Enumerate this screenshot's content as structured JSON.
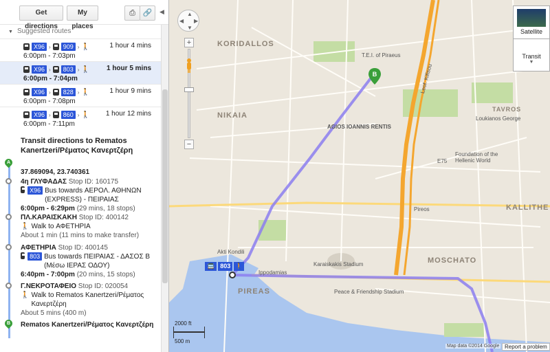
{
  "toolbar": {
    "get_directions": "Get directions",
    "my_places": "My places",
    "print_icon": "print-icon",
    "link_icon": "link-icon"
  },
  "sidebar": {
    "suggested_routes_label": "Suggested routes",
    "routes": [
      {
        "buses": [
          "X96",
          "909"
        ],
        "duration": "1 hour 4 mins",
        "times": "6:00pm - 7:03pm",
        "selected": false
      },
      {
        "buses": [
          "X96",
          "803"
        ],
        "duration": "1 hour 5 mins",
        "times": "6:00pm - 7:04pm",
        "selected": true
      },
      {
        "buses": [
          "X96",
          "828"
        ],
        "duration": "1 hour 9 mins",
        "times": "6:00pm - 7:08pm",
        "selected": false
      },
      {
        "buses": [
          "X96",
          "860"
        ],
        "duration": "1 hour 12 mins",
        "times": "6:00pm - 7:11pm",
        "selected": false
      }
    ],
    "directions_title": "Transit directions to Rematos Kanertzeri/Ρέματος Κανερτζέρη",
    "start": {
      "marker": "A",
      "coords": "37.869094, 23.740361"
    },
    "steps": [
      {
        "stop": "4η ΓΛΥΦΑΔΑΣ",
        "stop_id": "Stop ID: 160175",
        "bus": "X96",
        "desc": "Bus towards ΑΕΡΟΛ. ΑΘΗΝΩΝ (EXPRESS) - ΠΕΙΡΑΙΑΣ",
        "time": "6:00pm - 6:29pm",
        "detail": "(29 mins, 18 stops)"
      },
      {
        "stop": "ΠΛ.ΚΑΡΑΙΣΚΑΚΗ",
        "stop_id": "Stop ID: 400142",
        "walk": "Walk to ΑΦΕΤΗΡΙΑ",
        "about": "About 1 min (11 mins to make transfer)"
      },
      {
        "stop": "ΑΦΕΤΗΡΙΑ",
        "stop_id": "Stop ID: 400145",
        "bus": "803",
        "desc": "Bus towards ΠΕΙΡΑΙΑΣ - ΔΑΣΟΣ Β (Μέσω ΙΕΡΑΣ ΟΔΟΥ)",
        "time": "6:40pm - 7:00pm",
        "detail": "(20 mins, 15 stops)"
      },
      {
        "stop": "Γ.ΝΕΚΡΟΤΑΦΕΙΟ",
        "stop_id": "Stop ID: 020054",
        "walk": "Walk to Rematos Kanertzeri/Ρέματος Κανερτζέρη",
        "about": "About 5 mins (400 m)"
      }
    ],
    "end": {
      "marker": "B",
      "label": "Rematos Kanertzeri/Ρέματος Κανερτζέρη"
    }
  },
  "map": {
    "map_types": {
      "satellite": "Satellite",
      "transit": "Transit"
    },
    "labels": {
      "koridallos": "KORIDALLOS",
      "nikaia": "NIKAIA",
      "agios_ioannis": "AGIOS IOANNIS RENTIS",
      "tavros": "TAVROS",
      "kallithea": "KALLITHE",
      "moschato": "MOSCHATO",
      "pireas": "PIREAS",
      "karaiskakis": "Karaiskakis Stadium",
      "peace_friendship": "Peace & Friendship Stadium",
      "lekkas_e75": "E75",
      "akti_kondili": "Akti Kondili",
      "ippodamias": "Ippodamias",
      "teipir": "T.E.I. of Piraeus",
      "loukianos": "Loukianos George",
      "foundation": "Foundation of the Hellenic World",
      "kifisos": "Leof. Kifisou",
      "pireos": "Pireos"
    },
    "route_badge": "803",
    "scale": {
      "ft": "2000 ft",
      "m": "500 m"
    },
    "attribution": "Map data ©2014 Google",
    "report": "Report a problem",
    "colors": {
      "route": "#8c7ef0",
      "highway": "#f4a62f",
      "green": "#c4dda4",
      "water": "#aac6ef"
    }
  }
}
